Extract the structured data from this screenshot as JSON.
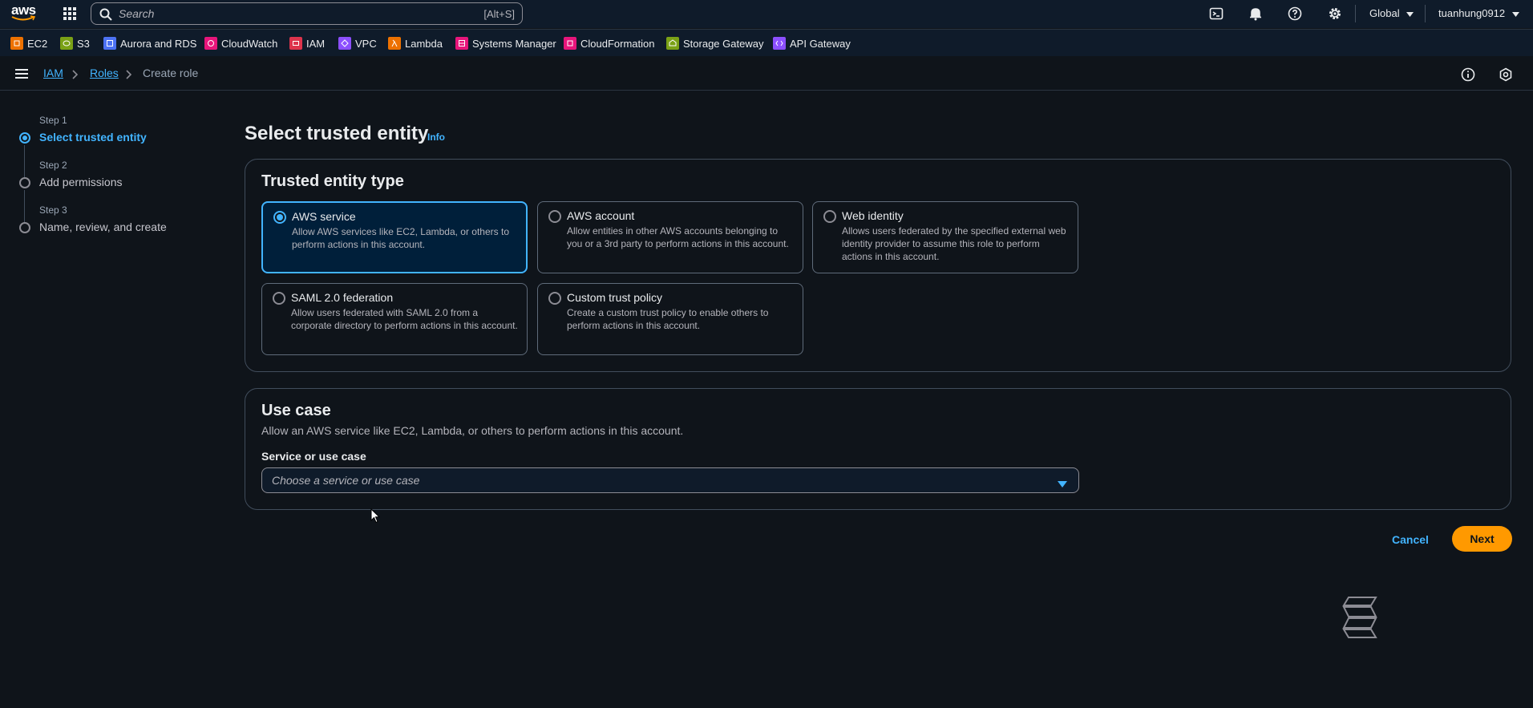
{
  "topnav": {
    "logo_text": "aws",
    "search_placeholder": "Search",
    "search_shortcut": "[Alt+S]",
    "region": "Global",
    "account": "tuanhung0912",
    "icons": [
      "cloudshell-icon",
      "bell-icon",
      "help-icon",
      "gear-icon"
    ]
  },
  "favorites": [
    {
      "label": "EC2",
      "color": "#ed7100"
    },
    {
      "label": "S3",
      "color": "#7aa116"
    },
    {
      "label": "Aurora and RDS",
      "color": "#4d72f3"
    },
    {
      "label": "CloudWatch",
      "color": "#e7157b"
    },
    {
      "label": "IAM",
      "color": "#dd344c"
    },
    {
      "label": "VPC",
      "color": "#8c4fff"
    },
    {
      "label": "Lambda",
      "color": "#ed7100"
    },
    {
      "label": "Systems Manager",
      "color": "#e7157b"
    },
    {
      "label": "CloudFormation",
      "color": "#e7157b"
    },
    {
      "label": "Storage Gateway",
      "color": "#7aa116"
    },
    {
      "label": "API Gateway",
      "color": "#8c4fff"
    }
  ],
  "breadcrumb": {
    "items": [
      "IAM",
      "Roles"
    ],
    "current": "Create role"
  },
  "steps": [
    {
      "label": "Step 1",
      "name": "Select trusted entity",
      "active": true
    },
    {
      "label": "Step 2",
      "name": "Add permissions",
      "active": false
    },
    {
      "label": "Step 3",
      "name": "Name, review, and create",
      "active": false
    }
  ],
  "main": {
    "title": "Select trusted entity",
    "info": "Info"
  },
  "trusted_entity": {
    "title": "Trusted entity type",
    "selected": "AWS service",
    "options": [
      {
        "title": "AWS service",
        "desc": "Allow AWS services like EC2, Lambda, or others to perform actions in this account."
      },
      {
        "title": "AWS account",
        "desc": "Allow entities in other AWS accounts belonging to you or a 3rd party to perform actions in this account."
      },
      {
        "title": "Web identity",
        "desc": "Allows users federated by the specified external web identity provider to assume this role to perform actions in this account."
      },
      {
        "title": "SAML 2.0 federation",
        "desc": "Allow users federated with SAML 2.0 from a corporate directory to perform actions in this account."
      },
      {
        "title": "Custom trust policy",
        "desc": "Create a custom trust policy to enable others to perform actions in this account."
      }
    ]
  },
  "use_case": {
    "title": "Use case",
    "desc": "Allow an AWS service like EC2, Lambda, or others to perform actions in this account.",
    "field_label": "Service or use case",
    "placeholder": "Choose a service or use case"
  },
  "actions": {
    "cancel": "Cancel",
    "next": "Next"
  },
  "colors": {
    "accent": "#42b4ff",
    "primary_button": "#ff9900",
    "background": "#0f141a",
    "header": "#0f1b2a"
  }
}
